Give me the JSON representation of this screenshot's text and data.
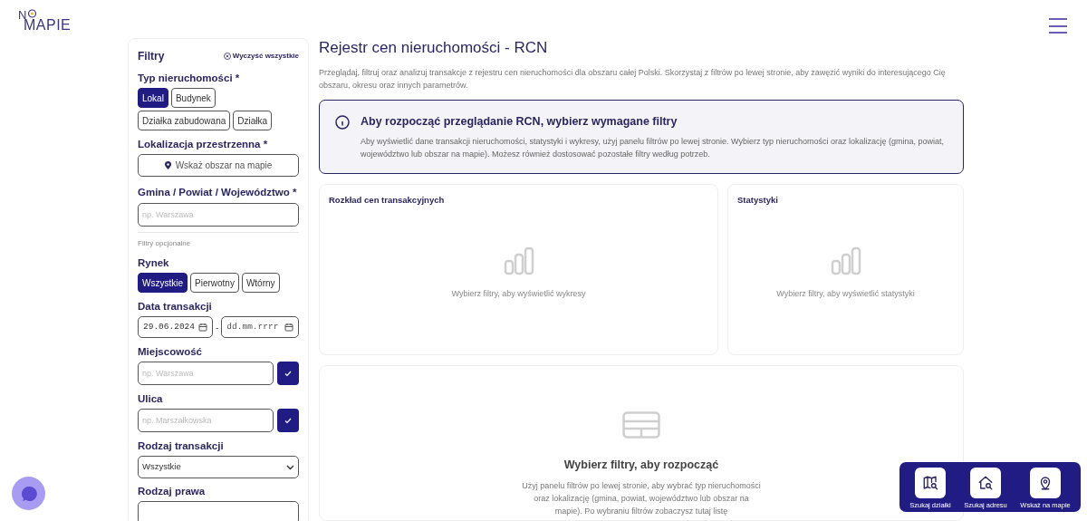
{
  "logo": {
    "top": "N",
    "bottom": "MAPIE"
  },
  "filters": {
    "title": "Filtry",
    "clear": "Wyczyść wszystkie",
    "property_type": {
      "label": "Typ nieruchomości *",
      "options": [
        {
          "label": "Lokal",
          "selected": true
        },
        {
          "label": "Budynek",
          "selected": false
        },
        {
          "label": "Działka zabudowana",
          "selected": false
        },
        {
          "label": "Działka",
          "selected": false
        }
      ]
    },
    "location": {
      "label": "Lokalizacja przestrzenna *",
      "button": "Wskaż obszar na mapie"
    },
    "municipality": {
      "label": "Gmina / Powiat / Województwo *",
      "placeholder": "np. Warszawa"
    },
    "optional_heading": "Filtry opcjonalne",
    "market": {
      "label": "Rynek",
      "options": [
        {
          "label": "Wszystkie",
          "selected": true
        },
        {
          "label": "Pierwotny",
          "selected": false
        },
        {
          "label": "Wtórny",
          "selected": false
        }
      ]
    },
    "date": {
      "label": "Data transakcji",
      "from": "29.06.2024",
      "separator": "-",
      "to_placeholder": "dd.mm.rrrr"
    },
    "city": {
      "label": "Miejscowość",
      "placeholder": "np. Warszawa"
    },
    "street": {
      "label": "Ulica",
      "placeholder": "np. Marszałkowska"
    },
    "transaction_type": {
      "label": "Rodzaj transakcji",
      "value": "Wszystkie"
    },
    "right_type": {
      "label": "Rodzaj prawa"
    }
  },
  "main": {
    "title": "Rejestr cen nieruchomości - RCN",
    "description": "Przeglądaj, filtruj oraz analizuj transakcje z rejestru cen nieruchomości dla obszaru całej Polski. Skorzystaj z filtrów po lewej stronie, aby zawęzić wyniki do interesującego Cię obszaru, okresu oraz innych parametrów.",
    "alert": {
      "title": "Aby rozpocząć przeglądanie RCN, wybierz wymagane filtry",
      "text": "Aby wyświetlić dane transakcji nieruchomości, statystyki i wykresy, użyj panelu filtrów po lewej stronie. Wybierz typ nieruchomości oraz lokalizację (gmina, powiat, województwo lub obszar na mapie). Możesz również dostosować pozostałe filtry według potrzeb."
    },
    "cards": [
      {
        "title": "Rozkład cen transakcyjnych",
        "empty": "Wybierz filtry, aby wyświetlić wykresy"
      },
      {
        "title": "Statystyki",
        "empty": "Wybierz filtry, aby wyświetlić statystyki"
      }
    ],
    "results": {
      "title": "Wybierz filtry, aby rozpocząć",
      "text": "Użyj panelu filtrów po lewej stronie, aby wybrać typ nieruchomości oraz lokalizację (gmina, powiat, województwo lub obszar na mapie). Po wybraniu filtrów zobaczysz tutaj listę"
    }
  },
  "quick_actions": [
    {
      "kind": "parcel",
      "label": "Szukaj działki"
    },
    {
      "kind": "address",
      "label": "Szukaj adresu"
    },
    {
      "kind": "pin",
      "label": "Wskaż na mapie"
    }
  ]
}
